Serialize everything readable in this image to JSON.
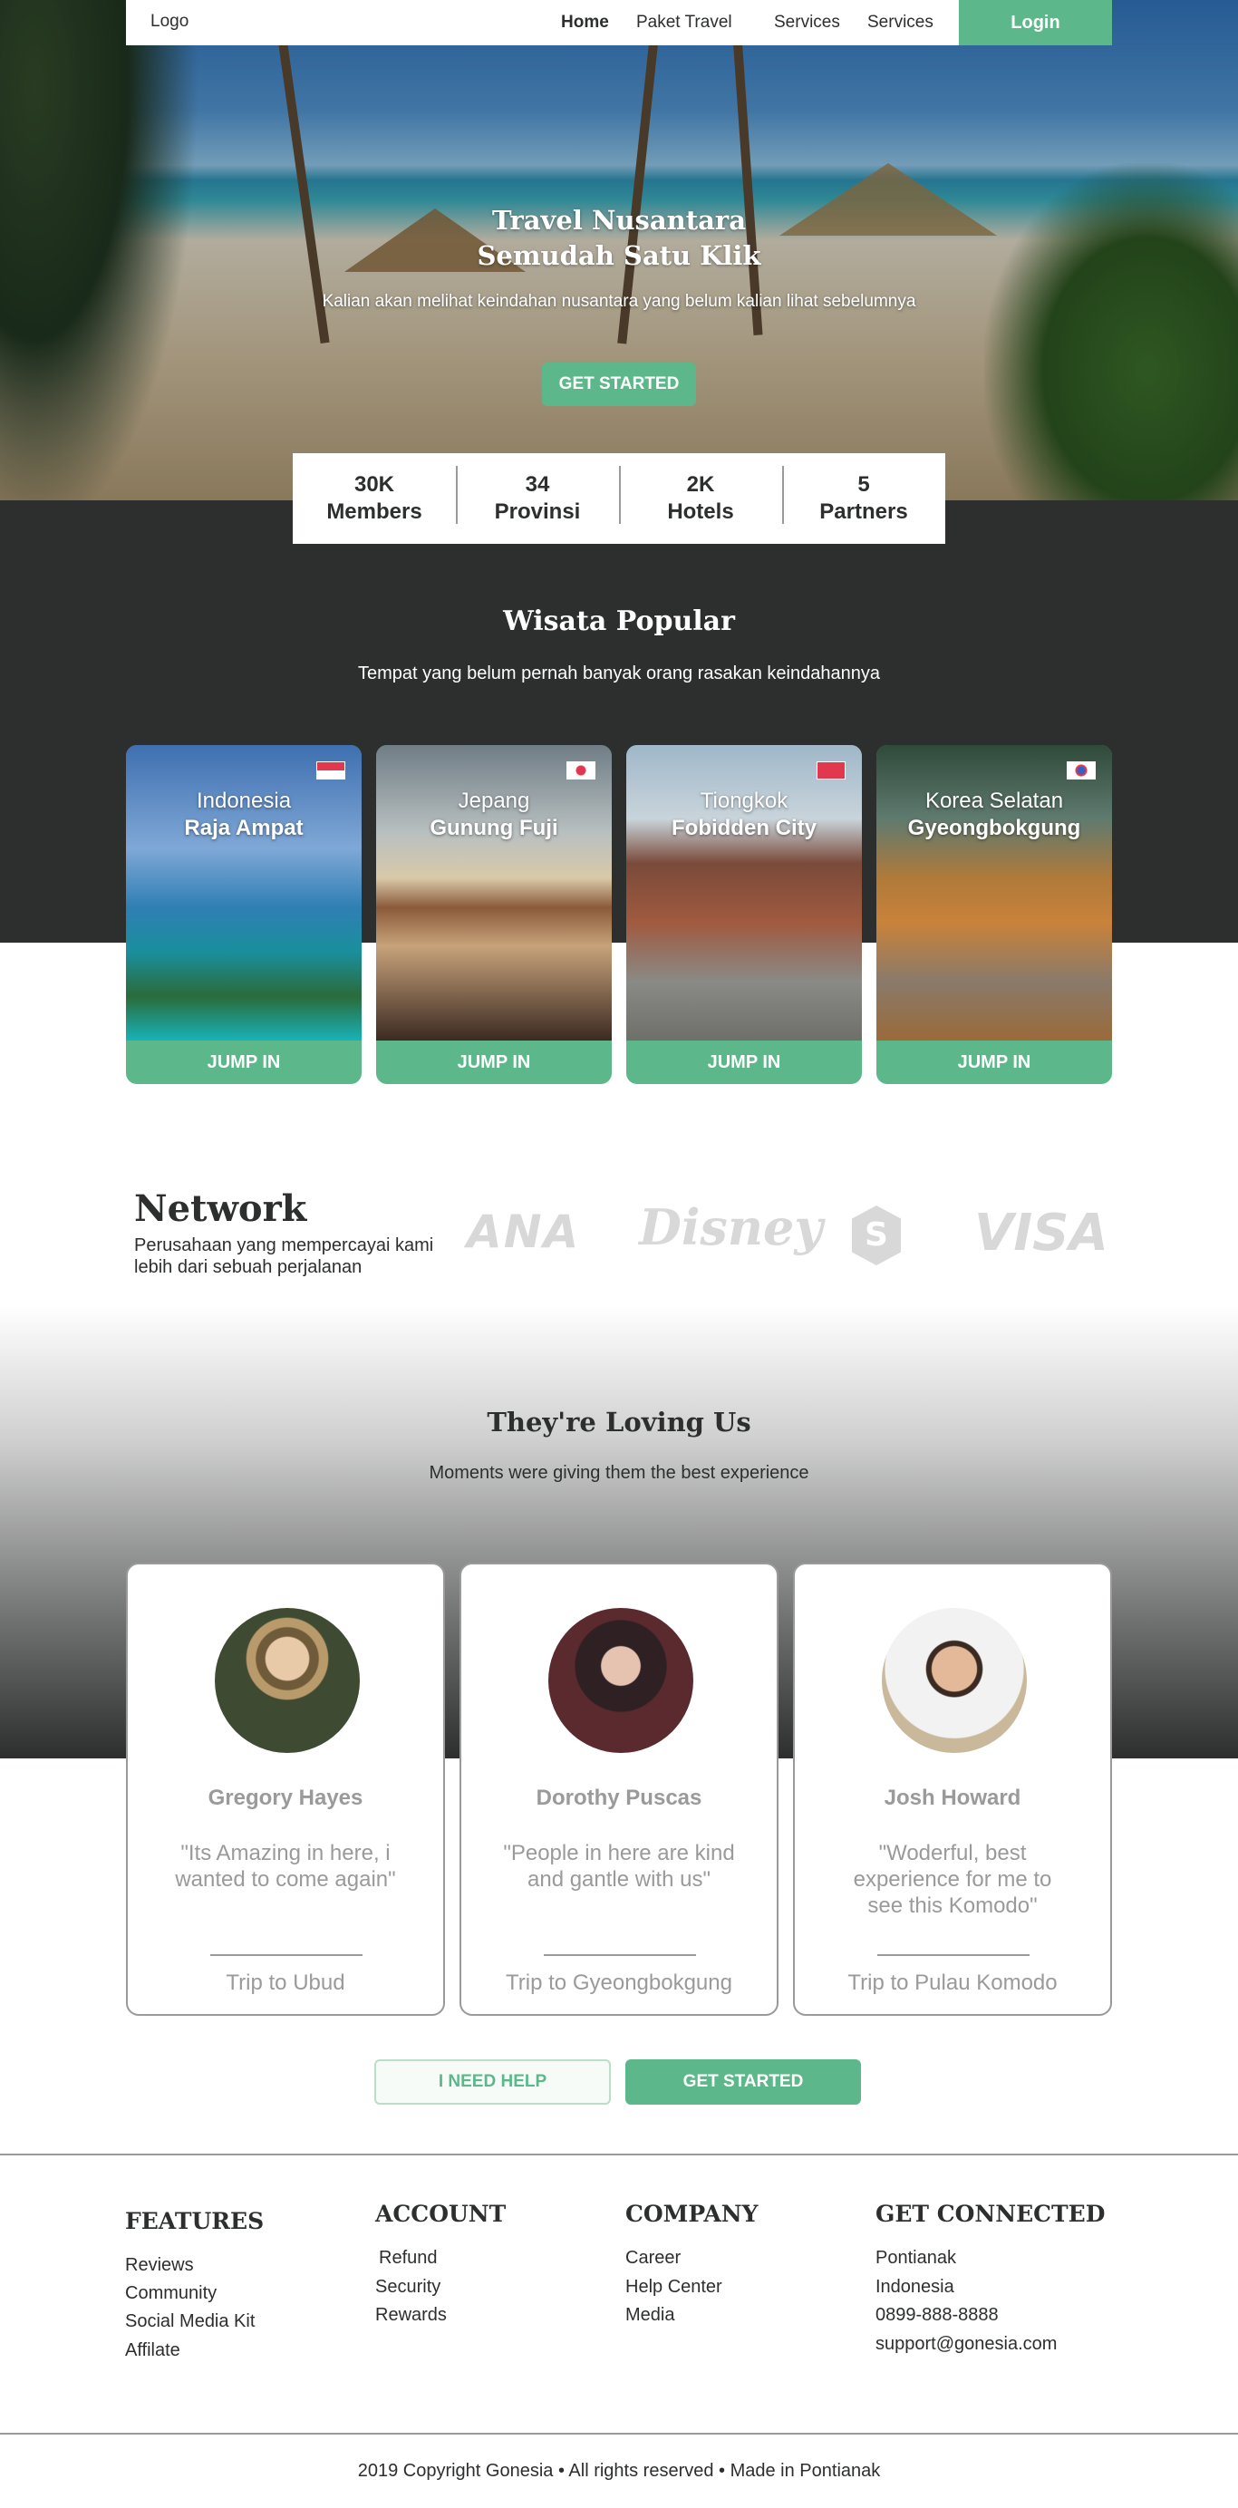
{
  "nav": {
    "logo": "Logo",
    "links": [
      "Home",
      "Paket Travel",
      "Services",
      "Services"
    ],
    "login": "Login"
  },
  "hero": {
    "title_line1": "Travel Nusantara",
    "title_line2": "Semudah Satu Klik",
    "subtitle": "Kalian akan melihat keindahan nusantara yang belum kalian lihat sebelumnya",
    "cta": "GET STARTED"
  },
  "stats": [
    {
      "value": "30K",
      "label": "Members"
    },
    {
      "value": "34",
      "label": "Provinsi"
    },
    {
      "value": "2K",
      "label": "Hotels"
    },
    {
      "value": "5",
      "label": "Partners"
    }
  ],
  "popular": {
    "title": "Wisata Popular",
    "subtitle": "Tempat yang belum pernah banyak orang rasakan keindahannya",
    "cards": [
      {
        "country": "Indonesia",
        "place": "Raja Ampat",
        "button": "JUMP IN",
        "flag": "indonesia-flag"
      },
      {
        "country": "Jepang",
        "place": "Gunung Fuji",
        "button": "JUMP IN",
        "flag": "japan-flag"
      },
      {
        "country": "Tiongkok",
        "place": "Fobidden City",
        "button": "JUMP IN",
        "flag": "china-flag"
      },
      {
        "country": "Korea Selatan",
        "place": "Gyeongbokgung",
        "button": "JUMP IN",
        "flag": "korea-flag"
      }
    ]
  },
  "network": {
    "title": "Network",
    "subtitle": "Perusahaan yang mempercayai kami lebih dari sebuah perjalanan",
    "logos": [
      "ANA",
      "Disney",
      "S",
      "VISA"
    ]
  },
  "testimonials": {
    "title": "They're Loving Us",
    "subtitle": "Moments were giving them the best experience",
    "items": [
      {
        "name": "Gregory Hayes",
        "quote": "\"Its Amazing in here, i wanted to come again\"",
        "trip": "Trip to Ubud"
      },
      {
        "name": "Dorothy Puscas",
        "quote": "\"People in here are kind and gantle with us\"",
        "trip": "Trip to Gyeongbokgung"
      },
      {
        "name": "Josh Howard",
        "quote": "\"Woderful, best experience for me to see this Komodo\"",
        "trip": "Trip to Pulau Komodo"
      }
    ]
  },
  "actions": {
    "help": "I NEED HELP",
    "start": "GET STARTED"
  },
  "footer": {
    "features": {
      "title": "FEATURES",
      "items": [
        "Reviews",
        "Community",
        "Social Media Kit",
        "Affilate"
      ]
    },
    "account": {
      "title": "ACCOUNT",
      "items": [
        "Refund",
        "Security",
        "Rewards"
      ]
    },
    "company": {
      "title": "COMPANY",
      "items": [
        "Career",
        "Help Center",
        "Media"
      ]
    },
    "connected": {
      "title": "GET CONNECTED",
      "items": [
        "Pontianak",
        "Indonesia",
        "0899-888-8888",
        "support@gonesia.com"
      ]
    },
    "copyright": "2019 Copyright Gonesia • All rights reserved • Made in Pontianak"
  },
  "colors": {
    "accent": "#5cb88a",
    "dark": "#2d2f2e",
    "muted": "#9a9a9a"
  }
}
